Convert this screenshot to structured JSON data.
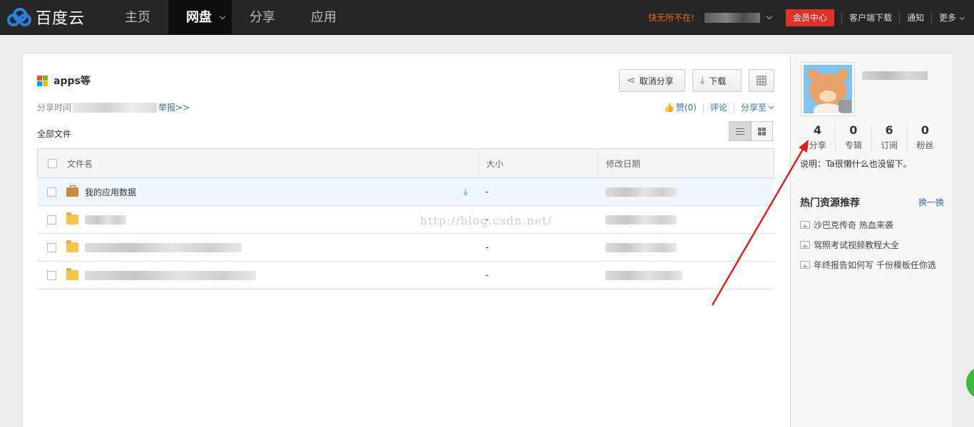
{
  "brand": {
    "name": "百度云"
  },
  "nav": {
    "items": [
      {
        "label": "主页",
        "active": false
      },
      {
        "label": "网盘",
        "active": true
      },
      {
        "label": "分享",
        "active": false
      },
      {
        "label": "应用",
        "active": false
      }
    ]
  },
  "header_right": {
    "promo": "快无所不在!",
    "vip": "会员中心",
    "client_download": "客户端下载",
    "notify": "通知",
    "more": "更多"
  },
  "share": {
    "title": "apps等",
    "time_label": "分享时间",
    "report": "举报>>",
    "cancel_share": "取消分享",
    "download": "下载",
    "like": "赞(0)",
    "comment": "评论",
    "share_to": "分享至",
    "all_files": "全部文件"
  },
  "table": {
    "headers": {
      "name": "文件名",
      "size": "大小",
      "date": "修改日期"
    },
    "rows": [
      {
        "name": "我的应用数据",
        "size": "-",
        "type": "app-folder"
      },
      {
        "name": "",
        "size": "-",
        "type": "folder"
      },
      {
        "name": "",
        "size": "-",
        "type": "folder"
      },
      {
        "name": "",
        "size": "-",
        "type": "folder"
      }
    ]
  },
  "watermark": "http://blog.csdn.net/",
  "profile": {
    "stats": [
      {
        "num": "4",
        "label": "分享"
      },
      {
        "num": "0",
        "label": "专辑"
      },
      {
        "num": "6",
        "label": "订阅"
      },
      {
        "num": "0",
        "label": "粉丝"
      }
    ],
    "description": "说明：Ta很懒什么也没留下。"
  },
  "hot": {
    "title": "热门资源推荐",
    "refresh": "换一换",
    "items": [
      "沙巴克传奇 热血来袭",
      "驾照考试视频教程大全",
      "年终报告如何写 千份模板任你选"
    ]
  },
  "colors": {
    "accent": "#2d7ed8",
    "vip": "#e0322a",
    "promo": "#f06a1e",
    "link": "#3b6fb6",
    "arrow": "#e02020"
  },
  "icons": [
    "baidu-cloud-logo-icon",
    "share-icon",
    "download-icon",
    "qrcode-icon",
    "list-view-icon",
    "grid-view-icon",
    "thumb-up-icon",
    "folder-icon",
    "briefcase-icon",
    "image-icon"
  ]
}
